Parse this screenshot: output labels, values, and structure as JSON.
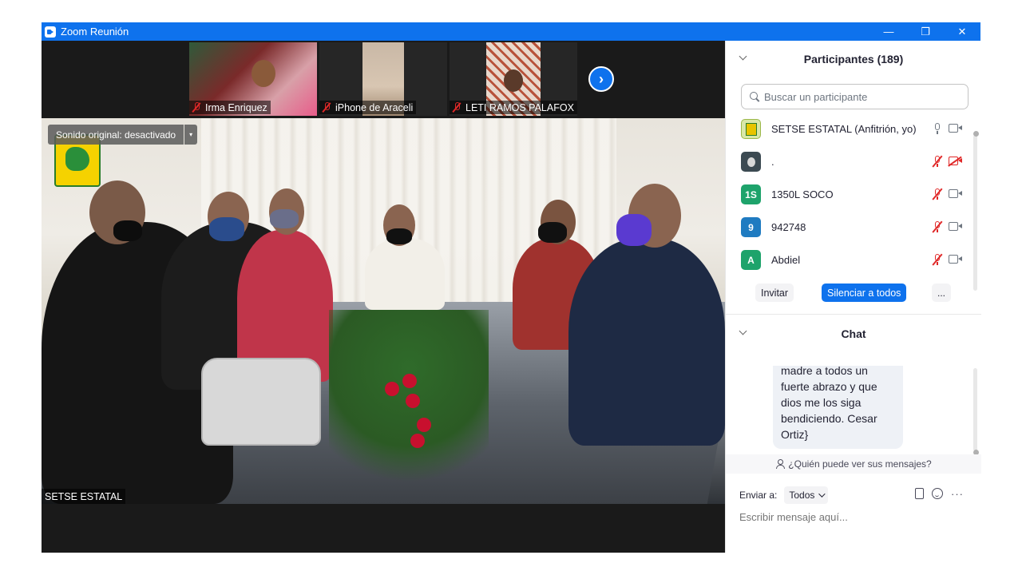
{
  "window": {
    "title": "Zoom Reunión",
    "minimize_glyph": "—",
    "restore_glyph": "❐",
    "close_glyph": "✕"
  },
  "thumbnails": [
    {
      "name": "Irma Enriquez",
      "muted": true
    },
    {
      "name": "iPhone de Araceli",
      "muted": true
    },
    {
      "name": "LETI RAMOS PALAFOX",
      "muted": true
    }
  ],
  "thumb_next_glyph": "›",
  "main_video": {
    "audio_label": "Sonido original: desactivado",
    "audio_arrow": "▾",
    "speaker_name": "SETSE ESTATAL"
  },
  "participants": {
    "header": "Participantes (189)",
    "search_placeholder": "Buscar un participante",
    "list": [
      {
        "avatar_text": "",
        "avatar_color": "#d9e8a8",
        "name": "SETSE ESTATAL (Anfitrión, yo)",
        "mic": "on",
        "camera": "on"
      },
      {
        "avatar_text": "",
        "avatar_color": "#3c4a52",
        "name": ".",
        "mic": "off",
        "camera": "off"
      },
      {
        "avatar_text": "1S",
        "avatar_color": "#1ea36b",
        "name": "1350L SOCO",
        "mic": "off",
        "camera": "on"
      },
      {
        "avatar_text": "9",
        "avatar_color": "#1f7bc1",
        "name": "942748",
        "mic": "off",
        "camera": "on"
      },
      {
        "avatar_text": "A",
        "avatar_color": "#1ea36b",
        "name": "Abdiel",
        "mic": "off",
        "camera": "on"
      }
    ],
    "invite_label": "Invitar",
    "mute_all_label": "Silenciar a todos",
    "more_label": "..."
  },
  "chat": {
    "header": "Chat",
    "message_lines": [
      "madre a todos un",
      "fuerte abrazo y que",
      "dios me los siga",
      "bendiciendo. Cesar",
      "Ortiz}"
    ],
    "who_can_see": "¿Quién puede ver sus mensajes?",
    "send_to_label": "Enviar a:",
    "recipient": "Todos",
    "more_glyph": "···",
    "input_placeholder": "Escribir mensaje aquí..."
  },
  "colors": {
    "titlebar": "#0e72ed",
    "accent": "#0e72ed",
    "muted_red": "#e02828"
  }
}
